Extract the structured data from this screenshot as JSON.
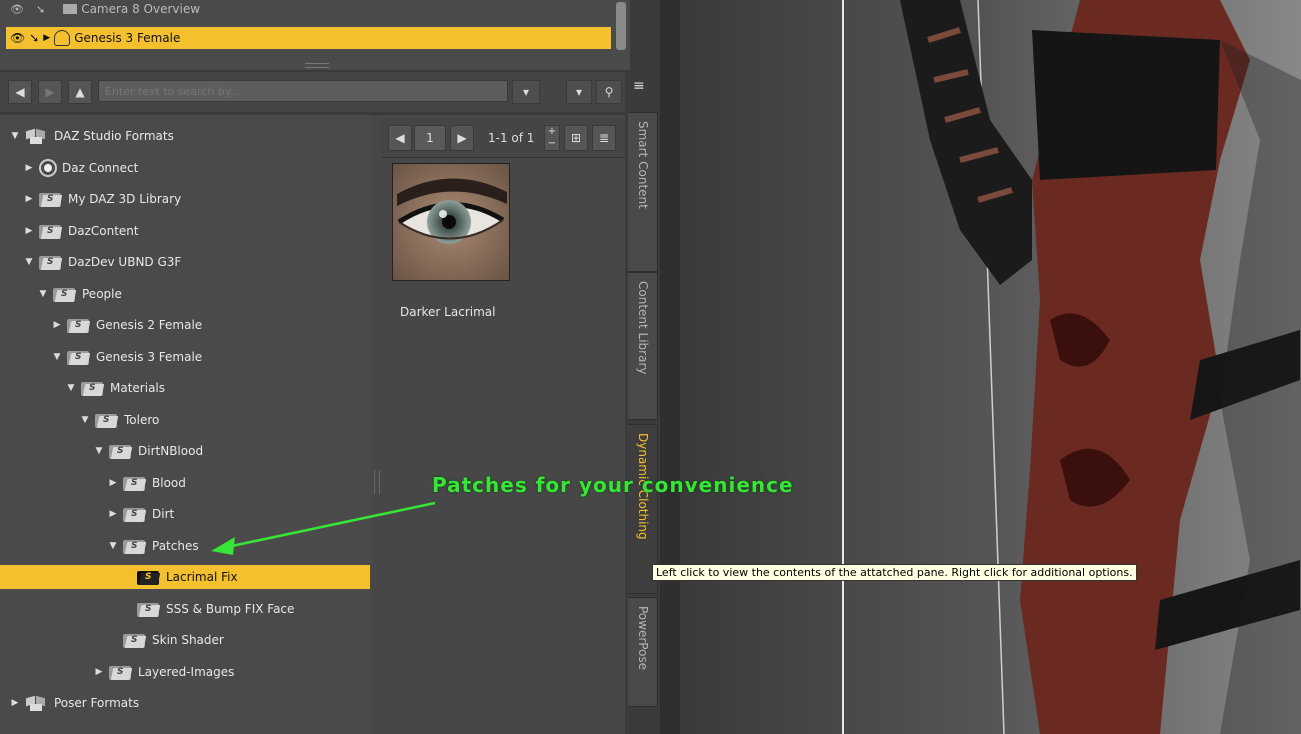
{
  "scene": {
    "rows": [
      {
        "label": "Camera 8 Overview",
        "selected": false
      },
      {
        "label": "Genesis 3 Female",
        "selected": true
      }
    ]
  },
  "search": {
    "placeholder": "Enter text to search by..."
  },
  "tree": {
    "items": [
      {
        "label": "DAZ Studio Formats",
        "icon": "package-icon",
        "depth": 0,
        "expanded": true,
        "has_children": true,
        "selected": false
      },
      {
        "label": "Daz Connect",
        "icon": "daz-connect-icon",
        "depth": 1,
        "expanded": false,
        "has_children": true,
        "selected": false
      },
      {
        "label": "My DAZ 3D Library",
        "icon": "folder-icon",
        "depth": 1,
        "expanded": false,
        "has_children": true,
        "selected": false
      },
      {
        "label": "DazContent",
        "icon": "folder-icon",
        "depth": 1,
        "expanded": false,
        "has_children": true,
        "selected": false
      },
      {
        "label": "DazDev UBND G3F",
        "icon": "folder-icon",
        "depth": 1,
        "expanded": true,
        "has_children": true,
        "selected": false
      },
      {
        "label": "People",
        "icon": "folder-icon",
        "depth": 2,
        "expanded": true,
        "has_children": true,
        "selected": false
      },
      {
        "label": "Genesis 2 Female",
        "icon": "folder-icon",
        "depth": 3,
        "expanded": false,
        "has_children": true,
        "selected": false
      },
      {
        "label": "Genesis 3 Female",
        "icon": "folder-icon",
        "depth": 3,
        "expanded": true,
        "has_children": true,
        "selected": false
      },
      {
        "label": "Materials",
        "icon": "folder-icon",
        "depth": 4,
        "expanded": true,
        "has_children": true,
        "selected": false
      },
      {
        "label": "Tolero",
        "icon": "folder-icon",
        "depth": 5,
        "expanded": true,
        "has_children": true,
        "selected": false
      },
      {
        "label": "DirtNBlood",
        "icon": "folder-icon",
        "depth": 6,
        "expanded": true,
        "has_children": true,
        "selected": false
      },
      {
        "label": "Blood",
        "icon": "folder-icon",
        "depth": 7,
        "expanded": false,
        "has_children": true,
        "selected": false
      },
      {
        "label": "Dirt",
        "icon": "folder-icon",
        "depth": 7,
        "expanded": false,
        "has_children": true,
        "selected": false
      },
      {
        "label": "Patches",
        "icon": "folder-icon",
        "depth": 7,
        "expanded": true,
        "has_children": true,
        "selected": false
      },
      {
        "label": "Lacrimal Fix",
        "icon": "folder-icon",
        "depth": 8,
        "expanded": false,
        "has_children": false,
        "selected": true
      },
      {
        "label": "SSS & Bump FIX Face",
        "icon": "folder-icon",
        "depth": 8,
        "expanded": false,
        "has_children": false,
        "selected": false
      },
      {
        "label": "Skin Shader",
        "icon": "folder-icon",
        "depth": 7,
        "expanded": false,
        "has_children": false,
        "selected": false
      },
      {
        "label": "Layered-Images",
        "icon": "folder-icon",
        "depth": 6,
        "expanded": false,
        "has_children": true,
        "selected": false
      },
      {
        "label": "Poser Formats",
        "icon": "package-icon",
        "depth": 0,
        "expanded": false,
        "has_children": true,
        "selected": false
      }
    ]
  },
  "content": {
    "page_number": "1",
    "page_count": "1-1 of 1",
    "items": [
      {
        "label": "Darker Lacrimal"
      }
    ]
  },
  "tabs": [
    {
      "label": "Smart Content",
      "active": false
    },
    {
      "label": "Content Library",
      "active": false
    },
    {
      "label": "Dynamic Clothing",
      "active": true
    },
    {
      "label": "PowerPose",
      "active": false
    }
  ],
  "tooltip": {
    "text": "Left click to view the contents of the attatched pane. Right click for additional options."
  },
  "annotation": {
    "text": "Patches for your convenience"
  },
  "colors": {
    "selection": "#f5c02e",
    "annotation": "#36e536",
    "panel": "#4a4a4a"
  }
}
